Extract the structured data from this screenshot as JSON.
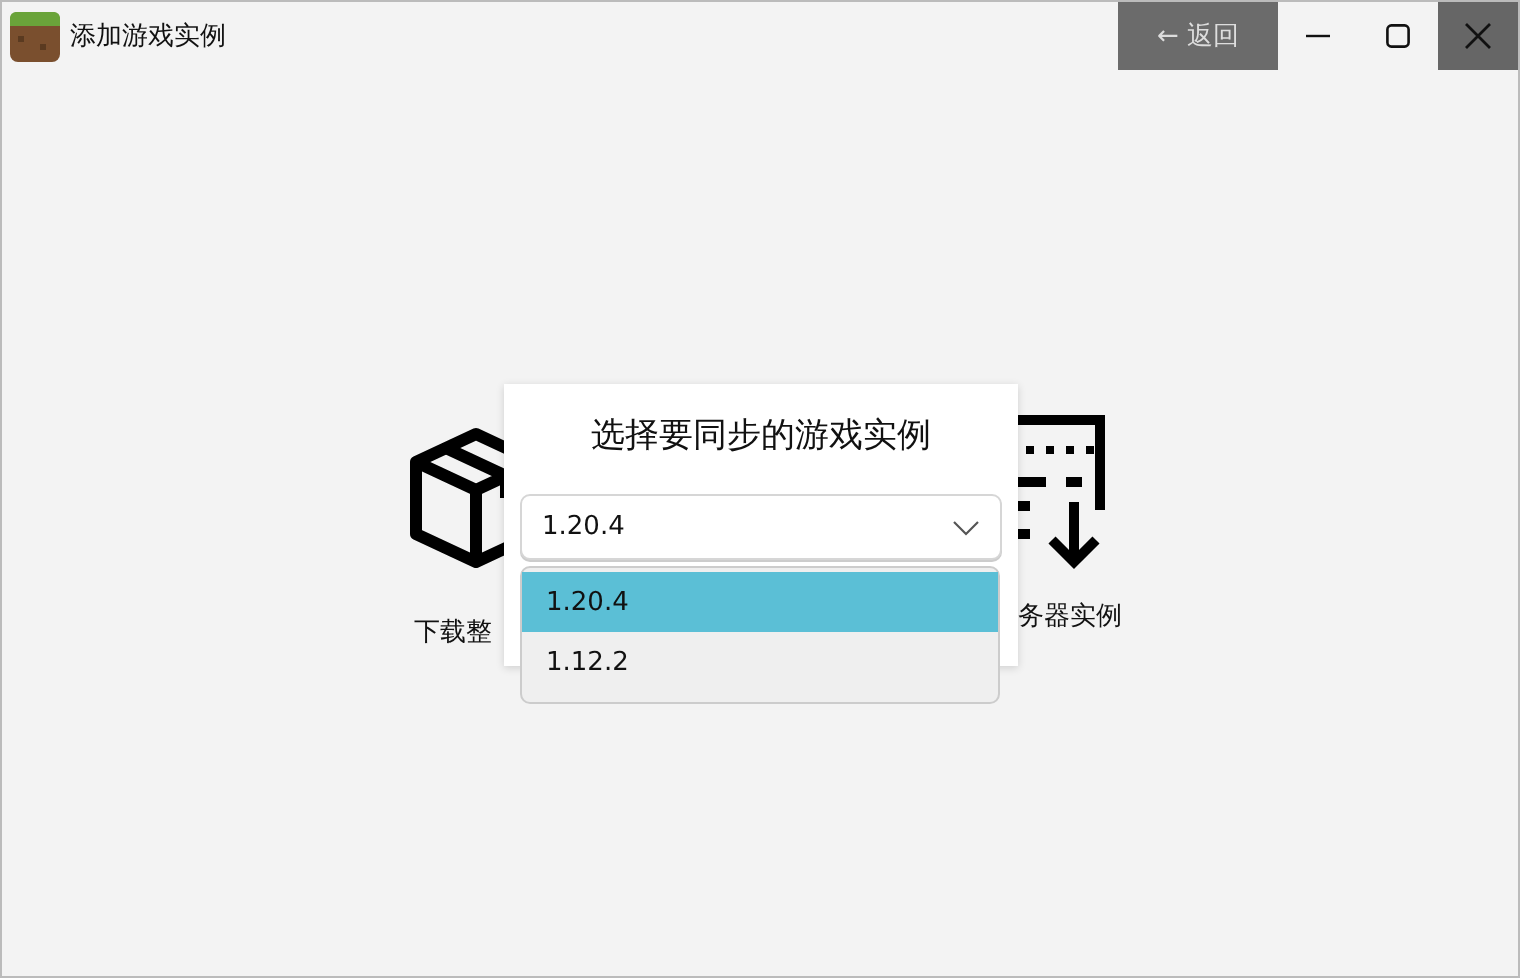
{
  "window": {
    "title": "添加游戏实例",
    "back_button": "← 返回"
  },
  "options": [
    {
      "kind": "box",
      "label": "下载整"
    },
    {
      "kind": "server",
      "label": "务器实例"
    }
  ],
  "dialog": {
    "title": "选择要同步的游戏实例",
    "select": {
      "value": "1.20.4",
      "expanded": true,
      "options": [
        {
          "label": "1.20.4",
          "selected": true
        },
        {
          "label": "1.12.2",
          "selected": false
        }
      ]
    }
  }
}
